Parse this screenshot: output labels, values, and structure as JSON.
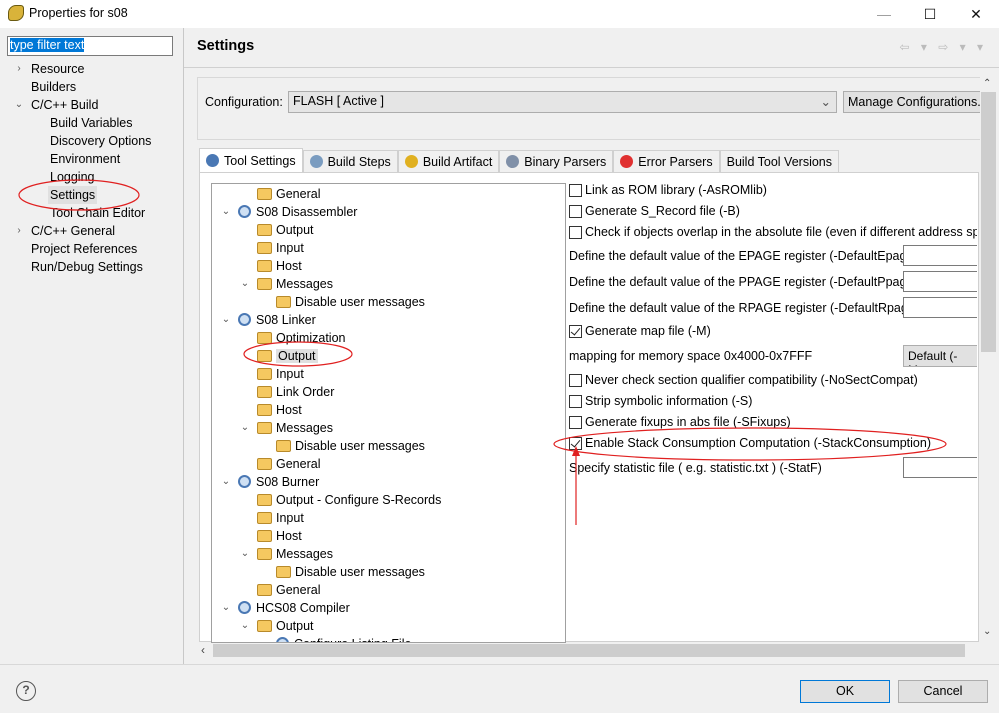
{
  "window": {
    "title": "Properties for s08",
    "minimize": "—",
    "maximize": "☐",
    "close": "✕"
  },
  "filter": {
    "value": "type filter text"
  },
  "nav_tree": [
    {
      "label": "Resource",
      "level": 0,
      "expander": "›"
    },
    {
      "label": "Builders",
      "level": 0,
      "expander": ""
    },
    {
      "label": "C/C++ Build",
      "level": 0,
      "expander": "⌄"
    },
    {
      "label": "Build Variables",
      "level": 1,
      "expander": ""
    },
    {
      "label": "Discovery Options",
      "level": 1,
      "expander": ""
    },
    {
      "label": "Environment",
      "level": 1,
      "expander": ""
    },
    {
      "label": "Logging",
      "level": 1,
      "expander": ""
    },
    {
      "label": "Settings",
      "level": 1,
      "expander": "",
      "selected": true
    },
    {
      "label": "Tool Chain Editor",
      "level": 1,
      "expander": ""
    },
    {
      "label": "C/C++ General",
      "level": 0,
      "expander": "›"
    },
    {
      "label": "Project References",
      "level": 0,
      "expander": ""
    },
    {
      "label": "Run/Debug Settings",
      "level": 0,
      "expander": ""
    }
  ],
  "header": {
    "title": "Settings",
    "nav_arrows": "⇦ ▾ ⇨ ▾ ▾"
  },
  "configuration": {
    "label": "Configuration:",
    "value": "FLASH  [ Active ]",
    "manage_button": "Manage Configurations..."
  },
  "tabs": [
    {
      "label": "Tool Settings",
      "icon": "tool-settings-icon",
      "color": "#4a78b4",
      "active": true
    },
    {
      "label": "Build Steps",
      "icon": "build-steps-icon",
      "color": "#7a9cc0"
    },
    {
      "label": "Build Artifact",
      "icon": "trophy-icon",
      "color": "#e0b020"
    },
    {
      "label": "Binary Parsers",
      "icon": "binary-file-icon",
      "color": "#8090a8"
    },
    {
      "label": "Error Parsers",
      "icon": "error-icon",
      "color": "#e03030"
    },
    {
      "label": "Build Tool Versions",
      "icon": "",
      "color": ""
    }
  ],
  "tool_tree": [
    {
      "label": "General",
      "level": 1,
      "icon": "folder",
      "expander": ""
    },
    {
      "label": "S08 Disassembler",
      "level": 0,
      "icon": "gear",
      "expander": "⌄"
    },
    {
      "label": "Output",
      "level": 1,
      "icon": "folder",
      "expander": ""
    },
    {
      "label": "Input",
      "level": 1,
      "icon": "folder",
      "expander": ""
    },
    {
      "label": "Host",
      "level": 1,
      "icon": "folder",
      "expander": ""
    },
    {
      "label": "Messages",
      "level": 1,
      "icon": "folder",
      "expander": "⌄"
    },
    {
      "label": "Disable user messages",
      "level": 2,
      "icon": "folder",
      "expander": ""
    },
    {
      "label": "S08 Linker",
      "level": 0,
      "icon": "gear",
      "expander": "⌄"
    },
    {
      "label": "Optimization",
      "level": 1,
      "icon": "folder",
      "expander": ""
    },
    {
      "label": "Output",
      "level": 1,
      "icon": "folder",
      "expander": "",
      "selected": true
    },
    {
      "label": "Input",
      "level": 1,
      "icon": "folder",
      "expander": ""
    },
    {
      "label": "Link Order",
      "level": 1,
      "icon": "folder",
      "expander": ""
    },
    {
      "label": "Host",
      "level": 1,
      "icon": "folder",
      "expander": ""
    },
    {
      "label": "Messages",
      "level": 1,
      "icon": "folder",
      "expander": "⌄"
    },
    {
      "label": "Disable user messages",
      "level": 2,
      "icon": "folder",
      "expander": ""
    },
    {
      "label": "General",
      "level": 1,
      "icon": "folder",
      "expander": ""
    },
    {
      "label": "S08 Burner",
      "level": 0,
      "icon": "gear",
      "expander": "⌄"
    },
    {
      "label": "Output - Configure S-Records",
      "level": 1,
      "icon": "folder",
      "expander": ""
    },
    {
      "label": "Input",
      "level": 1,
      "icon": "folder",
      "expander": ""
    },
    {
      "label": "Host",
      "level": 1,
      "icon": "folder",
      "expander": ""
    },
    {
      "label": "Messages",
      "level": 1,
      "icon": "folder",
      "expander": "⌄"
    },
    {
      "label": "Disable user messages",
      "level": 2,
      "icon": "folder",
      "expander": ""
    },
    {
      "label": "General",
      "level": 1,
      "icon": "folder",
      "expander": ""
    },
    {
      "label": "HCS08 Compiler",
      "level": 0,
      "icon": "gear",
      "expander": "⌄"
    },
    {
      "label": "Output",
      "level": 1,
      "icon": "folder",
      "expander": "⌄"
    },
    {
      "label": "Configure Listing File",
      "level": 2,
      "icon": "gear",
      "expander": ""
    }
  ],
  "options": [
    {
      "type": "checkbox",
      "label": "Link as ROM library (-AsROMlib)",
      "checked": false
    },
    {
      "type": "checkbox",
      "label": "Generate S_Record file (-B)",
      "checked": false
    },
    {
      "type": "checkbox",
      "label": "Check if objects overlap in the absolute file (even if different address space",
      "checked": false
    },
    {
      "type": "text",
      "label": "Define the default value of the EPAGE register (-DefaultEpage)",
      "value": ""
    },
    {
      "type": "text",
      "label": "Define the default value of the PPAGE register (-DefaultPpage)",
      "value": ""
    },
    {
      "type": "text",
      "label": "Define the default value of the RPAGE register (-DefaultRpage)",
      "value": ""
    },
    {
      "type": "checkbox",
      "label": "Generate map file (-M)",
      "checked": true
    },
    {
      "type": "select",
      "label": "mapping for memory space 0x4000-0x7FFF",
      "value": "Default (-Map"
    },
    {
      "type": "checkbox",
      "label": "Never check section qualifier compatibility (-NoSectCompat)",
      "checked": false
    },
    {
      "type": "checkbox",
      "label": "Strip symbolic information (-S)",
      "checked": false
    },
    {
      "type": "checkbox",
      "label": "Generate fixups in abs file (-SFixups)",
      "checked": false
    },
    {
      "type": "checkbox",
      "label": "Enable Stack Consumption Computation (-StackConsumption)",
      "checked": true
    },
    {
      "type": "text",
      "label": "Specify statistic file ( e.g. statistic.txt ) (-StatF)",
      "value": ""
    }
  ],
  "buttons": {
    "help": "?",
    "ok": "OK",
    "cancel": "Cancel"
  },
  "annotation_color": "#e02020"
}
